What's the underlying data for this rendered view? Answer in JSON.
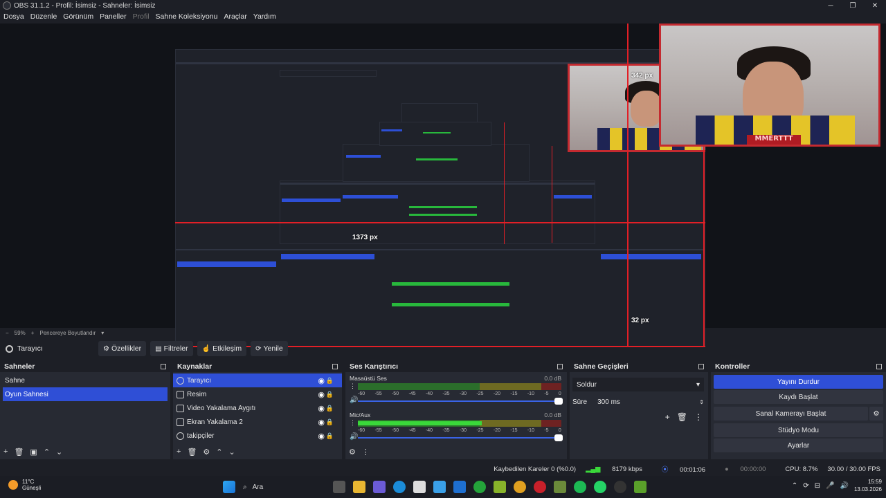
{
  "window": {
    "title": "OBS 31.1.2 - Profil: İsimsiz - Sahneler: İsimsiz",
    "minimize": "─",
    "maximize": "❐",
    "close": "✕"
  },
  "menu": [
    "Dosya",
    "Düzenle",
    "Görünüm",
    "Paneller",
    "Profil",
    "Sahne Koleksiyonu",
    "Araçlar",
    "Yardım"
  ],
  "preview": {
    "label_width": "1373 px",
    "label_top": "342 px",
    "label_bottom": "32 px",
    "webcam_banner": "MMERTTT"
  },
  "zoom": {
    "minus": "−",
    "value": "59%",
    "plus": "+",
    "fit": "Pencereye Boyutlandır",
    "chevron": "▾"
  },
  "source_toolbar": {
    "selected_source": "Tarayıcı",
    "properties": "Özellikler",
    "filters": "Filtreler",
    "interact": "Etkileşim",
    "refresh": "Yenile"
  },
  "scenes": {
    "title": "Sahneler",
    "items": [
      "Sahne",
      "Oyun Sahnesi"
    ],
    "active_index": 1
  },
  "sources": {
    "title": "Kaynaklar",
    "items": [
      "Tarayıcı",
      "Resim",
      "Video Yakalama Aygıtı",
      "Ekran Yakalama 2",
      "takipçiler"
    ]
  },
  "mixer": {
    "title": "Ses Karıştırıcı",
    "tracks": [
      {
        "name": "Masaüstü Ses",
        "db": "0.0 dB",
        "level": 0
      },
      {
        "name": "Mic/Aux",
        "db": "0.0 dB",
        "level": 0.61
      }
    ],
    "ticks": [
      "-60",
      "-55",
      "-50",
      "-45",
      "-40",
      "-35",
      "-30",
      "-25",
      "-20",
      "-15",
      "-10",
      "-5",
      "0"
    ]
  },
  "transitions": {
    "title": "Sahne Geçişleri",
    "selected": "Soldur",
    "duration_label": "Süre",
    "duration_value": "300 ms"
  },
  "controls": {
    "title": "Kontroller",
    "stop_stream": "Yayını Durdur",
    "start_record": "Kaydı Başlat",
    "virtual_cam": "Sanal Kamerayı Başlat",
    "studio_mode": "Stüdyo Modu",
    "settings": "Ayarlar"
  },
  "status": {
    "dropped": "Kaybedilen Kareler 0 (%0.0)",
    "bitrate": "8179 kbps",
    "stream_time": "00:01:06",
    "record_time": "00:00:00",
    "cpu": "CPU: 8.7%",
    "fps": "30.00 / 30.00 FPS"
  },
  "taskbar": {
    "temp": "11°C",
    "weather": "Güneşli",
    "search": "Ara",
    "time": "15:59",
    "date": "13.03.2026"
  },
  "colors": {
    "accent": "#2f4fd6",
    "red_outline": "#e21f26",
    "meter_green": "#3ad83a"
  }
}
